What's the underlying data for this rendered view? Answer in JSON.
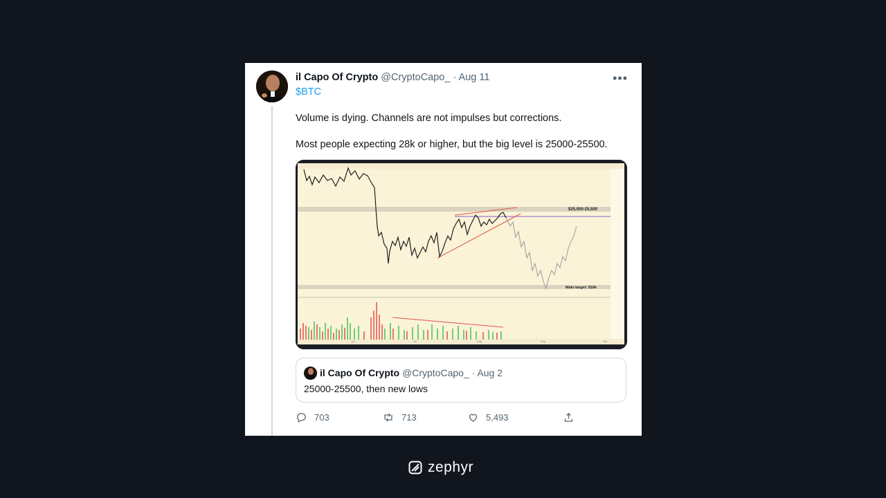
{
  "tweet": {
    "author_name": "il Capo Of Crypto",
    "handle": "@CryptoCapo_",
    "separator": "·",
    "date": "Aug 11",
    "cashtag": "$BTC",
    "paragraphs": [
      "Volume is dying. Channels are not impulses but corrections.",
      "Most people expecting 28k or higher, but the big level is 25000-25500."
    ],
    "chart": {
      "zone_label": "$25,000-25,500",
      "target_label": "Main target: $16k",
      "x_labels": [
        "Jun",
        "Jul",
        "Aug",
        "Sep",
        "Oct"
      ]
    }
  },
  "quoted": {
    "author_name": "il Capo Of Crypto",
    "handle": "@CryptoCapo_",
    "separator": "·",
    "date": "Aug 2",
    "text": "25000-25500, then new lows"
  },
  "actions": {
    "replies": "703",
    "retweets": "713",
    "likes": "5,493"
  },
  "brand": {
    "name": "zephyr"
  },
  "colors": {
    "background": "#10151e",
    "link": "#1d9bf0",
    "muted": "#536471",
    "chart_bg": "#fbf3d8",
    "trendline": "#e0524a",
    "level_line": "#8b5fc7"
  }
}
